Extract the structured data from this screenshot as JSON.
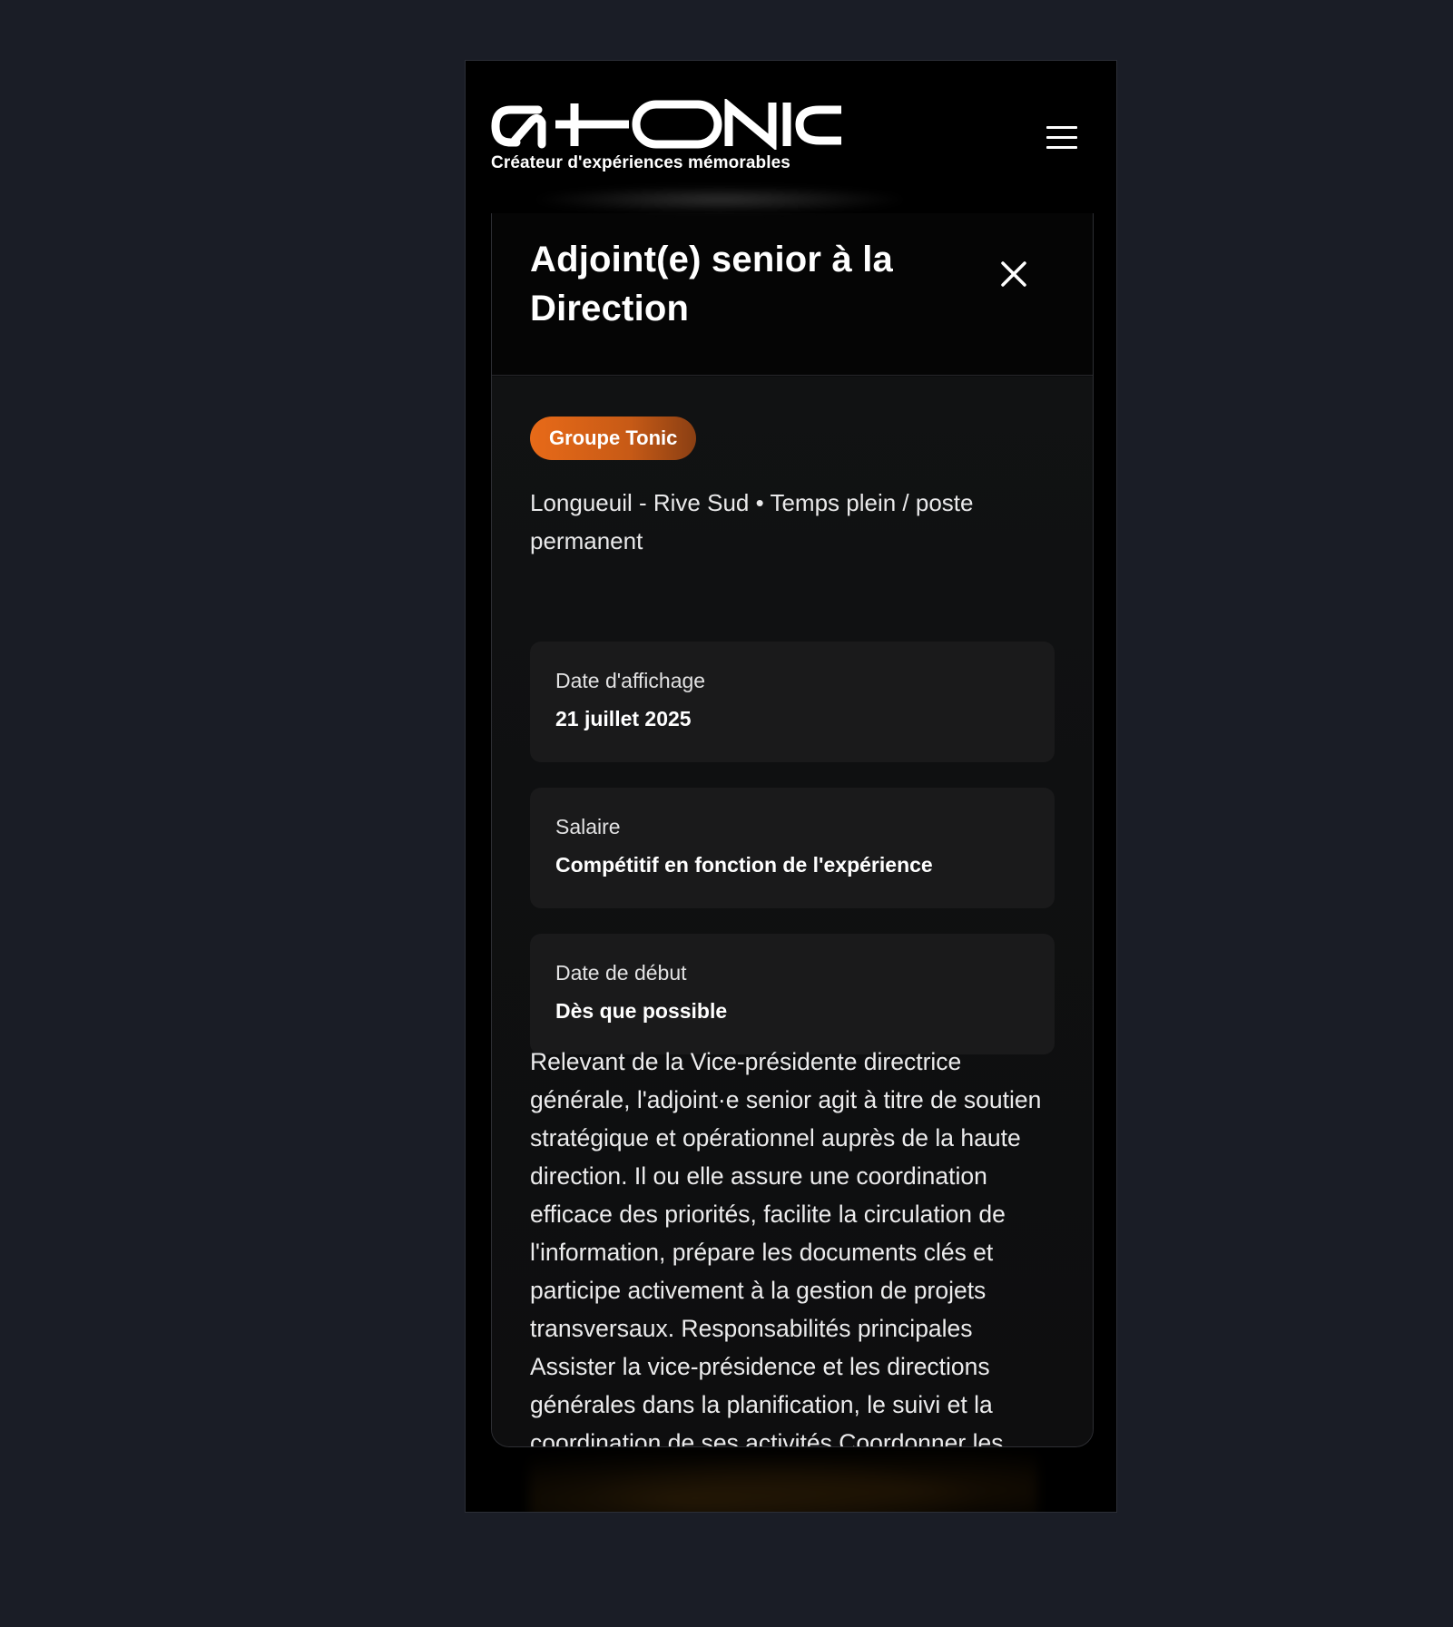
{
  "header": {
    "brand": "G+TONIC",
    "tagline": "Créateur d'expériences mémorables",
    "menu_icon": "hamburger-menu-icon"
  },
  "job": {
    "title_partial": "Adjoint(e) senior à la",
    "title_last_line": "Direction",
    "company_badge": "Groupe Tonic",
    "location_type": "Longueuil - Rive Sud • Temps plein / poste permanent",
    "details": [
      {
        "label": "Date d'affichage",
        "value": "21 juillet 2025"
      },
      {
        "label": "Salaire",
        "value": "Compétitif en fonction de l'expérience"
      },
      {
        "label": "Date de début",
        "value": "Dès que possible"
      }
    ],
    "description": "Relevant de la Vice-présidente directrice générale, l'adjoint·e senior agit à titre de soutien stratégique et opérationnel auprès de la haute direction. Il ou elle assure une coordination efficace des priorités, facilite la circulation de l'information, prépare les documents clés et participe activement à la gestion de projets transversaux. Responsabilités principales Assister la vice-présidence et les directions générales dans la planification, le suivi et la coordination de ses activités Coordonner les échanges avec les"
  },
  "colors": {
    "page_background": "#1a1d26",
    "badge_orange": "#e86a18"
  }
}
